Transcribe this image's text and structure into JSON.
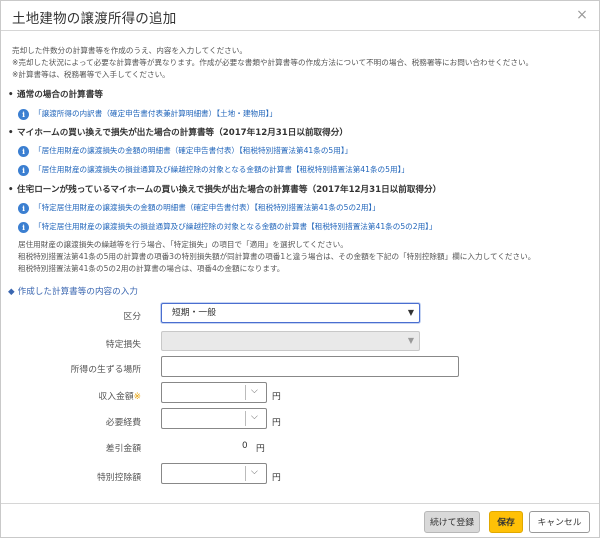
{
  "dialog": {
    "title": "土地建物の譲渡所得の追加",
    "close_symbol": "×"
  },
  "intro": [
    "売却した件数分の計算書等を作成のうえ、内容を入力してください。",
    "※売却した状況によって必要な計算書等が異なります。作成が必要な書類や計算書等の作成方法について不明の場合、税務署等にお問い合わせください。",
    "※計算書等は、税務署等で入手してください。"
  ],
  "sections": [
    {
      "heading": "通常の場合の計算書等",
      "links": [
        "「譲渡所得の内訳書（確定申告書付表兼計算明細書）【土地・建物用】」"
      ]
    },
    {
      "heading": "マイホームの買い換えで損失が出た場合の計算書等（2017年12月31日以前取得分）",
      "links": [
        "「居住用財産の譲渡損失の金額の明細書（確定申告書付表）【租税特別措置法第41条の5用】」",
        "「居住用財産の譲渡損失の損益通算及び繰越控除の対象となる金額の計算書【租税特別措置法第41条の5用】」"
      ]
    },
    {
      "heading": "住宅ローンが残っているマイホームの買い換えで損失が出た場合の計算書等（2017年12月31日以前取得分）",
      "links": [
        "「特定居住用財産の譲渡損失の金額の明細書（確定申告書付表）【租税特別措置法第41条の5の2用】」",
        "「特定居住用財産の譲渡損失の損益通算及び繰越控除の対象となる金額の計算書【租税特別措置法第41条の5の2用】」"
      ]
    }
  ],
  "note": [
    "居住用財産の譲渡損失の繰越等を行う場合、「特定損失」の項目で「適用」を選択してください。",
    "租税特別措置法第41条の5用の計算書の項番3の特別損失額が同計算書の項番1と違う場合は、その金額を下記の「特別控除額」欄に入力してください。",
    "租税特別措置法第41条の5の2用の計算書の場合は、項番4の金額になります。"
  ],
  "form": {
    "title": "作成した計算書等の内容の入力",
    "kubun": {
      "label": "区分",
      "value": "短期・一般"
    },
    "tokutei": {
      "label": "特定損失",
      "value": ""
    },
    "basho": {
      "label": "所得の生ずる場所",
      "value": ""
    },
    "shunyu": {
      "label": "収入金額",
      "required_mark": "※",
      "value": "",
      "unit": "円"
    },
    "keihi": {
      "label": "必要経費",
      "value": "",
      "unit": "円"
    },
    "sashihiki": {
      "label": "差引金額",
      "value": "0",
      "unit": "円"
    },
    "tokubetsu": {
      "label": "特別控除額",
      "value": "",
      "unit": "円"
    }
  },
  "footer": {
    "continue_label": "続けて登録",
    "save_label": "保存",
    "cancel_label": "キャンセル"
  },
  "colors": {
    "save_button": "#ffc107",
    "link": "#2266bb",
    "section_title": "#3a66b0"
  }
}
